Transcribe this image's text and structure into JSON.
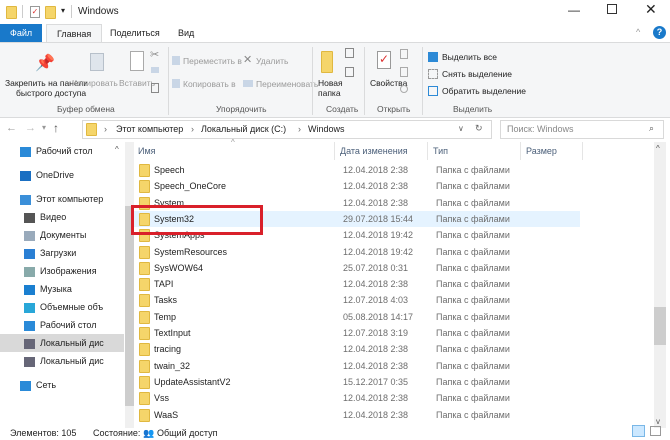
{
  "window": {
    "title": "Windows"
  },
  "tabs": [
    {
      "label": "Файл"
    },
    {
      "label": "Главная"
    },
    {
      "label": "Поделиться"
    },
    {
      "label": "Вид"
    }
  ],
  "ribbon": {
    "pin_line1": "Закрепить на панели",
    "pin_line2": "быстрого доступа",
    "copy": "Копировать",
    "paste": "Вставить",
    "group_clipboard": "Буфер обмена",
    "move_to": "Переместить в",
    "copy_to": "Копировать в",
    "delete": "Удалить",
    "rename": "Переименовать",
    "group_organize": "Упорядочить",
    "new_folder_line1": "Новая",
    "new_folder_line2": "папка",
    "group_create": "Создать",
    "properties": "Свойства",
    "group_open": "Открыть",
    "select_all": "Выделить все",
    "select_none": "Снять выделение",
    "invert_selection": "Обратить выделение",
    "group_select": "Выделить"
  },
  "address": {
    "crumbs": [
      "Этот компьютер",
      "Локальный диск (C:)",
      "Windows"
    ],
    "search_placeholder": "Поиск: Windows"
  },
  "sidebar": {
    "items": [
      {
        "label": "Рабочий стол",
        "icon": "desktop-icon"
      },
      {
        "label": "OneDrive",
        "icon": "onedrive-icon"
      },
      {
        "label": "Этот компьютер",
        "icon": "computer-icon"
      },
      {
        "label": "Видео",
        "icon": "video-icon"
      },
      {
        "label": "Документы",
        "icon": "documents-icon"
      },
      {
        "label": "Загрузки",
        "icon": "downloads-icon"
      },
      {
        "label": "Изображения",
        "icon": "pictures-icon"
      },
      {
        "label": "Музыка",
        "icon": "music-icon"
      },
      {
        "label": "Объемные объ",
        "icon": "3d-objects-icon"
      },
      {
        "label": "Рабочий стол",
        "icon": "desktop-icon"
      },
      {
        "label": "Локальный дис",
        "icon": "drive-icon"
      },
      {
        "label": "Локальный дис",
        "icon": "drive-icon"
      },
      {
        "label": "Сеть",
        "icon": "network-icon"
      }
    ]
  },
  "columns": {
    "name": "Имя",
    "date": "Дата изменения",
    "type": "Тип",
    "size": "Размер"
  },
  "files": [
    {
      "name": "Speech",
      "date": "12.04.2018 2:38",
      "type": "Папка с файлами"
    },
    {
      "name": "Speech_OneCore",
      "date": "12.04.2018 2:38",
      "type": "Папка с файлами"
    },
    {
      "name": "System",
      "date": "12.04.2018 2:38",
      "type": "Папка с файлами"
    },
    {
      "name": "System32",
      "date": "29.07.2018 15:44",
      "type": "Папка с файлами"
    },
    {
      "name": "SystemApps",
      "date": "12.04.2018 19:42",
      "type": "Папка с файлами"
    },
    {
      "name": "SystemResources",
      "date": "12.04.2018 19:42",
      "type": "Папка с файлами"
    },
    {
      "name": "SysWOW64",
      "date": "25.07.2018 0:31",
      "type": "Папка с файлами"
    },
    {
      "name": "TAPI",
      "date": "12.04.2018 2:38",
      "type": "Папка с файлами"
    },
    {
      "name": "Tasks",
      "date": "12.07.2018 4:03",
      "type": "Папка с файлами"
    },
    {
      "name": "Temp",
      "date": "05.08.2018 14:17",
      "type": "Папка с файлами"
    },
    {
      "name": "TextInput",
      "date": "12.07.2018 3:19",
      "type": "Папка с файлами"
    },
    {
      "name": "tracing",
      "date": "12.04.2018 2:38",
      "type": "Папка с файлами"
    },
    {
      "name": "twain_32",
      "date": "12.04.2018 2:38",
      "type": "Папка с файлами"
    },
    {
      "name": "UpdateAssistantV2",
      "date": "15.12.2017 0:35",
      "type": "Папка с файлами"
    },
    {
      "name": "Vss",
      "date": "12.04.2018 2:38",
      "type": "Папка с файлами"
    },
    {
      "name": "WaaS",
      "date": "12.04.2018 2:38",
      "type": "Папка с файлами"
    }
  ],
  "status": {
    "count": "Элементов: 105",
    "state_label": "Состояние:",
    "state_value": "Общий доступ"
  },
  "colors": {
    "accent": "#1979ca",
    "highlight": "#e5f3ff",
    "red_box": "#d9202a"
  }
}
